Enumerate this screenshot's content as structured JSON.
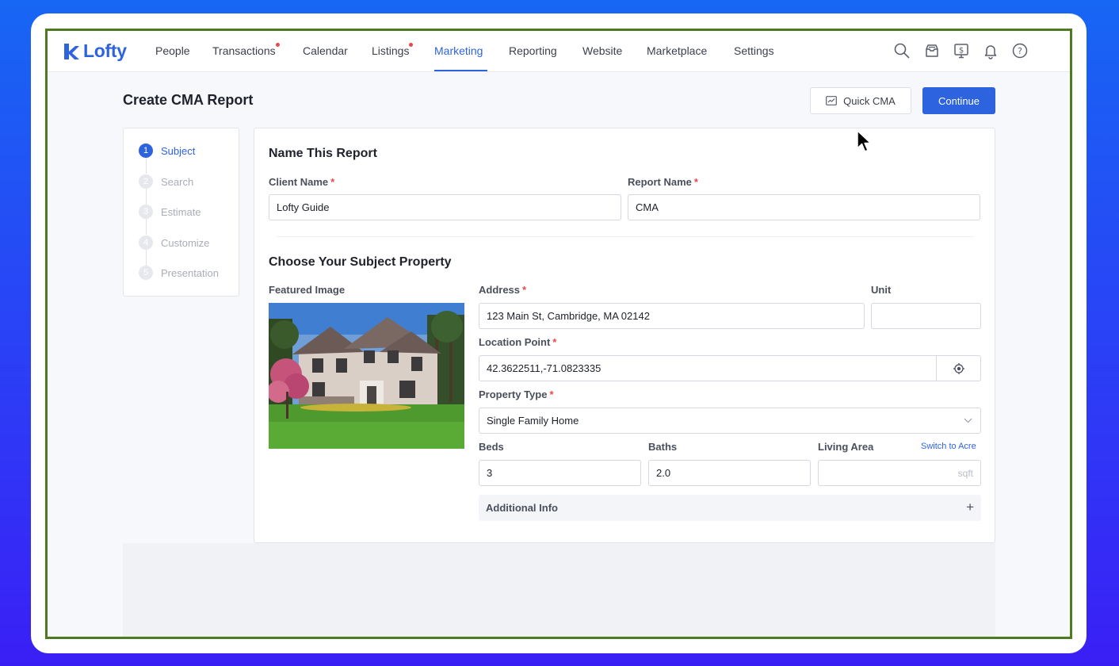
{
  "app": {
    "logo_text": "Lofty",
    "brand_color": "#2e63e0"
  },
  "nav": {
    "items": [
      {
        "label": "People",
        "badge": false,
        "active": false
      },
      {
        "label": "Transactions",
        "badge": true,
        "active": false
      },
      {
        "label": "Calendar",
        "badge": false,
        "active": false
      },
      {
        "label": "Listings",
        "badge": true,
        "active": false
      },
      {
        "label": "Marketing",
        "badge": false,
        "active": true
      },
      {
        "label": "Reporting",
        "badge": false,
        "active": false
      },
      {
        "label": "Website",
        "badge": false,
        "active": false
      },
      {
        "label": "Marketplace",
        "badge": false,
        "active": false
      },
      {
        "label": "Settings",
        "badge": false,
        "active": false
      }
    ],
    "icons": [
      "search-icon",
      "inbox-icon",
      "billing-monitor-icon",
      "bell-icon",
      "help-icon"
    ]
  },
  "page": {
    "title": "Create CMA Report",
    "quick_cma_label": "Quick CMA",
    "continue_label": "Continue"
  },
  "steps": [
    {
      "num": "1",
      "label": "Subject",
      "active": true
    },
    {
      "num": "2",
      "label": "Search",
      "active": false
    },
    {
      "num": "3",
      "label": "Estimate",
      "active": false
    },
    {
      "num": "4",
      "label": "Customize",
      "active": false
    },
    {
      "num": "5",
      "label": "Presentation",
      "active": false
    }
  ],
  "report": {
    "section_title": "Name This Report",
    "client_name_label": "Client Name",
    "client_name_value": "Lofty Guide",
    "report_name_label": "Report Name",
    "report_name_value": "CMA"
  },
  "subject": {
    "section_title": "Choose Your Subject Property",
    "featured_image_label": "Featured Image",
    "address_label": "Address",
    "address_value": "123 Main St, Cambridge, MA 02142",
    "unit_label": "Unit",
    "unit_value": "",
    "location_label": "Location Point",
    "location_value": "42.3622511,-71.0823335",
    "property_type_label": "Property Type",
    "property_type_value": "Single Family Home",
    "beds_label": "Beds",
    "beds_value": "3",
    "baths_label": "Baths",
    "baths_value": "2.0",
    "living_area_label": "Living Area",
    "living_area_placeholder": "sqft",
    "switch_link": "Switch to Acre",
    "additional_info_label": "Additional Info",
    "required_mark": "*"
  }
}
